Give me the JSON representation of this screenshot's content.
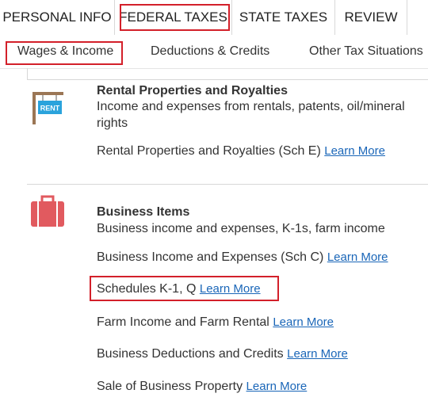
{
  "top_tabs": [
    {
      "label": "PERSONAL INFO"
    },
    {
      "label": "FEDERAL TAXES"
    },
    {
      "label": "STATE TAXES"
    },
    {
      "label": "REVIEW"
    }
  ],
  "sub_tabs": [
    {
      "label": "Wages & Income"
    },
    {
      "label": "Deductions & Credits"
    },
    {
      "label": "Other Tax Situations"
    }
  ],
  "rental": {
    "sign_text": "RENT",
    "title": "Rental Properties and Royalties",
    "description": "Income and expenses from rentals, patents, oil/mineral rights",
    "items": [
      {
        "label": "Rental Properties and Royalties (Sch E)",
        "link": "Learn More"
      }
    ]
  },
  "business": {
    "title": "Business Items",
    "description": "Business income and expenses, K-1s, farm income",
    "items": [
      {
        "label": "Business Income and Expenses (Sch C)",
        "link": "Learn More"
      },
      {
        "label": "Schedules K-1, Q",
        "link": "Learn More"
      },
      {
        "label": "Farm Income and Farm Rental",
        "link": "Learn More"
      },
      {
        "label": "Business Deductions and Credits",
        "link": "Learn More"
      },
      {
        "label": "Sale of Business Property",
        "link": "Learn More"
      }
    ]
  },
  "colors": {
    "highlight": "#d3202a",
    "link": "#1a66b8",
    "rent_sign": "#2aa3dc",
    "briefcase": "#e15a5f"
  }
}
